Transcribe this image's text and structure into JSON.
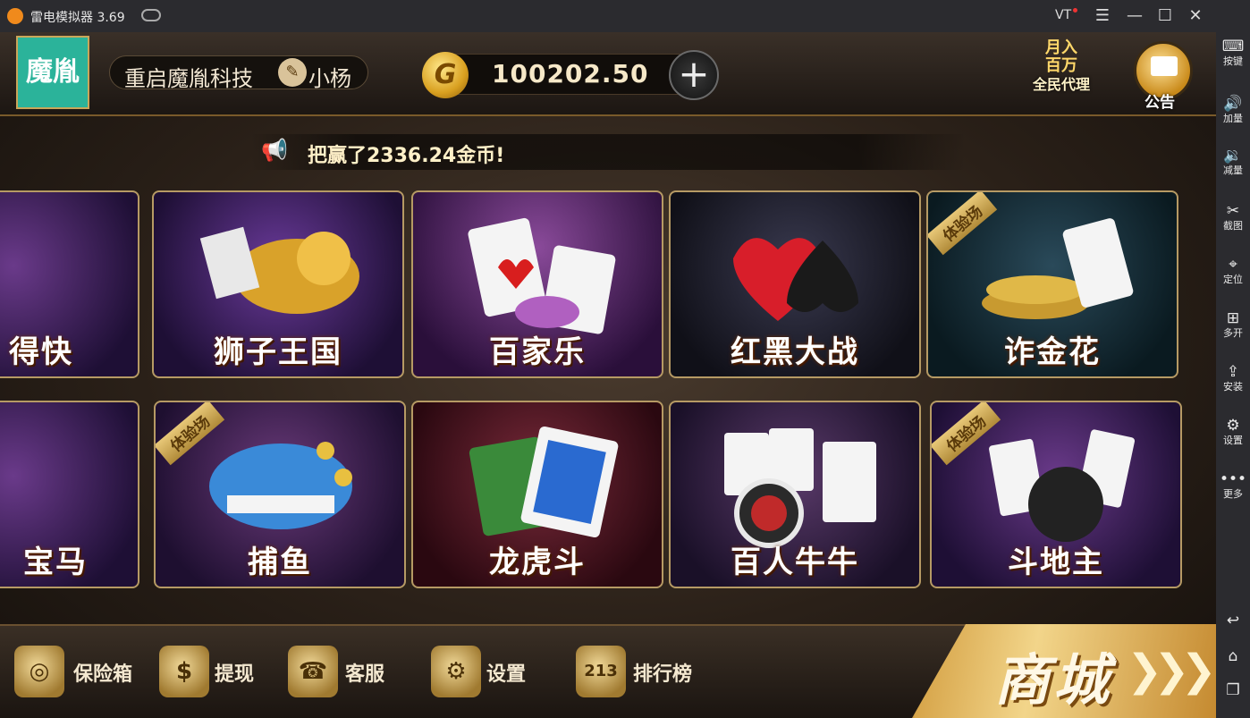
{
  "window": {
    "title": "雷电模拟器 3.69",
    "vt_label": "VT",
    "min_icon": "—",
    "max_icon": "☐",
    "close_icon": "✕",
    "menu_icon": "☰"
  },
  "sidebar": {
    "items": [
      {
        "icon": "⌨",
        "label": "按键"
      },
      {
        "icon": "🔊",
        "label": "加量"
      },
      {
        "icon": "🔉",
        "label": "减量"
      },
      {
        "icon": "✂",
        "label": "截图"
      },
      {
        "icon": "⌖",
        "label": "定位"
      },
      {
        "icon": "⊞",
        "label": "多开"
      },
      {
        "icon": "⇪",
        "label": "安装"
      },
      {
        "icon": "⚙",
        "label": "设置"
      },
      {
        "icon": "•••",
        "label": "更多"
      }
    ],
    "nav": {
      "back": "↩",
      "home": "⌂",
      "recent": "❐"
    }
  },
  "header": {
    "logo_text": "魔胤",
    "user_name": "重启魔胤科技",
    "user_name_tail": "小杨",
    "coin_symbol": "G",
    "coins": "100202.50",
    "add_label": "+",
    "agent": {
      "line1": "月入",
      "line2": "百万",
      "line3": "全民代理"
    },
    "notice_label": "公告"
  },
  "marquee": {
    "message": "把赢了2336.24金币!"
  },
  "games": {
    "row1": [
      {
        "name": "得快"
      },
      {
        "name": "狮子王国"
      },
      {
        "name": "百家乐"
      },
      {
        "name": "红黑大战"
      },
      {
        "name": "诈金花",
        "tag": "体验场"
      }
    ],
    "row2": [
      {
        "name": "宝马"
      },
      {
        "name": "捕鱼",
        "tag": "体验场"
      },
      {
        "name": "龙虎斗"
      },
      {
        "name": "百人牛牛"
      },
      {
        "name": "斗地主",
        "tag": "体验场"
      }
    ]
  },
  "bottom": {
    "safe": "保险箱",
    "withdraw": "提现",
    "service": "客服",
    "settings": "设置",
    "ranking": "排行榜",
    "ranking_icon": "213",
    "shop": "商城",
    "shop_arrows": "❯❯❯"
  }
}
